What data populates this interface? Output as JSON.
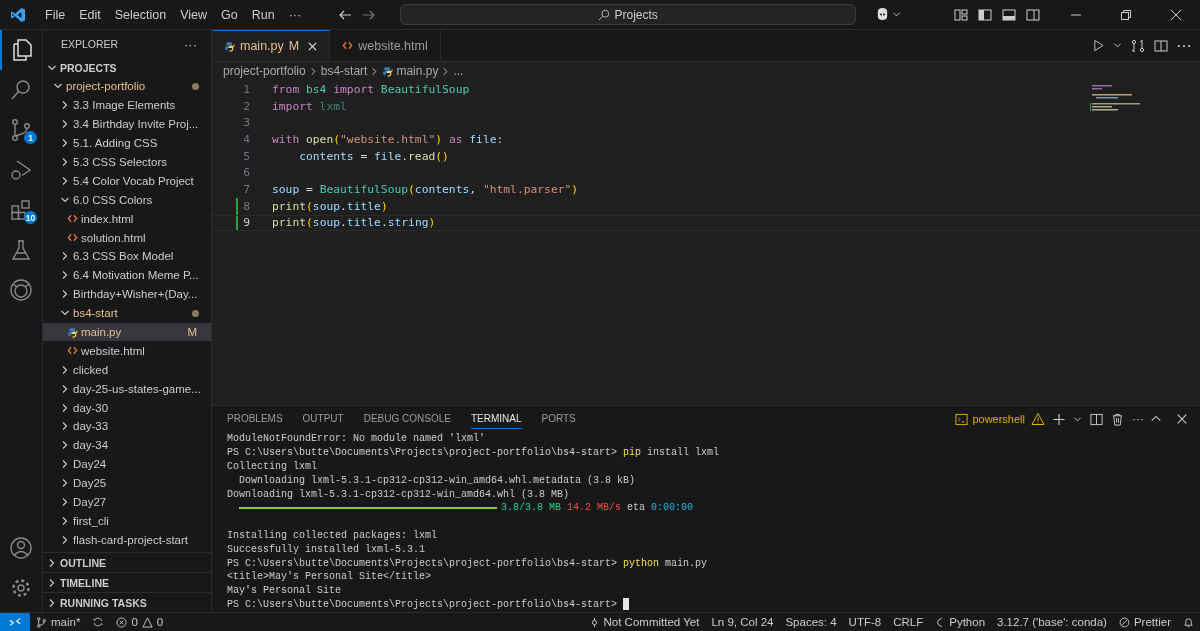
{
  "title_bar": {
    "menu": [
      "File",
      "Edit",
      "Selection",
      "View",
      "Go",
      "Run",
      "···"
    ],
    "search": {
      "value": "Projects"
    }
  },
  "activity_bar": {
    "items": [
      {
        "kind": "explorer",
        "selected": true
      },
      {
        "kind": "search",
        "selected": false
      },
      {
        "kind": "source-control",
        "selected": false,
        "badge": "1"
      },
      {
        "kind": "run",
        "selected": false
      },
      {
        "kind": "extensions",
        "selected": false,
        "badge": "10"
      },
      {
        "kind": "testing",
        "selected": false
      },
      {
        "kind": "copilot",
        "selected": false
      }
    ],
    "bottom": [
      {
        "kind": "account"
      },
      {
        "kind": "settings"
      }
    ]
  },
  "sidebar": {
    "title": "EXPLORER",
    "more": "···",
    "section": {
      "label": "PROJECTS",
      "expanded": true
    },
    "tree": [
      {
        "label": "project-portfolio",
        "kind": "folder",
        "expanded": true,
        "modified": true,
        "children": [
          {
            "label": "3.3 Image Elements",
            "kind": "folder",
            "expanded": false
          },
          {
            "label": "3.4 Birthday Invite Proj...",
            "kind": "folder",
            "expanded": false
          },
          {
            "label": "5.1. Adding CSS",
            "kind": "folder",
            "expanded": false
          },
          {
            "label": "5.3 CSS Selectors",
            "kind": "folder",
            "expanded": false
          },
          {
            "label": "5.4 Color Vocab Project",
            "kind": "folder",
            "expanded": false
          },
          {
            "label": "6.0 CSS Colors",
            "kind": "folder",
            "expanded": true,
            "modified": false,
            "children": [
              {
                "label": "index.html",
                "kind": "html",
                "selected": false
              },
              {
                "label": "solution.html",
                "kind": "html",
                "selected": false
              }
            ]
          },
          {
            "label": "6.3 CSS Box Model",
            "kind": "folder",
            "expanded": false
          },
          {
            "label": "6.4 Motivation Meme P...",
            "kind": "folder",
            "expanded": false
          },
          {
            "label": "Birthday+Wisher+(Day...",
            "kind": "folder",
            "expanded": false
          },
          {
            "label": "bs4-start",
            "kind": "folder",
            "expanded": true,
            "modified": true,
            "children": [
              {
                "label": "main.py",
                "kind": "python",
                "selected": true,
                "badge": "M"
              },
              {
                "label": "website.html",
                "kind": "html",
                "selected": false
              }
            ]
          },
          {
            "label": "clicked",
            "kind": "folder",
            "expanded": false
          },
          {
            "label": "day-25-us-states-game...",
            "kind": "folder",
            "expanded": false
          },
          {
            "label": "day-30",
            "kind": "folder",
            "expanded": false
          },
          {
            "label": "day-33",
            "kind": "folder",
            "expanded": false
          },
          {
            "label": "day-34",
            "kind": "folder",
            "expanded": false
          },
          {
            "label": "Day24",
            "kind": "folder",
            "expanded": false
          },
          {
            "label": "Day25",
            "kind": "folder",
            "expanded": false
          },
          {
            "label": "Day27",
            "kind": "folder",
            "expanded": false
          },
          {
            "label": "first_cli",
            "kind": "folder",
            "expanded": false
          },
          {
            "label": "flash-card-project-start",
            "kind": "folder",
            "expanded": false
          }
        ]
      }
    ],
    "sections": [
      {
        "label": "OUTLINE",
        "expanded": false
      },
      {
        "label": "TIMELINE",
        "expanded": false
      },
      {
        "label": "RUNNING TASKS",
        "expanded": false
      }
    ]
  },
  "editor": {
    "tabs": [
      {
        "label": "main.py",
        "kind": "python",
        "selected": true,
        "badge": "M"
      },
      {
        "label": "website.html",
        "kind": "html",
        "selected": false
      }
    ],
    "breadcrumb": [
      "project-portfolio",
      "bs4-start",
      "main.py",
      "..."
    ],
    "lines": [
      {
        "number": "1",
        "changed": false,
        "current": false,
        "tokens": [
          {
            "t": "from",
            "kind": "keyword"
          },
          {
            "t": " bs4 ",
            "kind": "type"
          },
          {
            "t": "import",
            "kind": "keyword"
          },
          {
            "t": " BeautifulSoup",
            "kind": "type"
          }
        ]
      },
      {
        "number": "2",
        "changed": false,
        "current": false,
        "tokens": [
          {
            "t": "import",
            "kind": "keyword"
          },
          {
            "t": " lxml",
            "kind": "unused"
          }
        ]
      },
      {
        "number": "3",
        "changed": false,
        "current": false
      },
      {
        "number": "4",
        "changed": false,
        "current": false,
        "tokens": [
          {
            "t": "with",
            "kind": "keyword"
          },
          {
            "t": " open",
            "kind": "function"
          },
          {
            "t": "(",
            "kind": "bracket"
          },
          {
            "t": "\"website.html\"",
            "kind": "string"
          },
          {
            "t": ")",
            "kind": "bracket"
          },
          {
            "t": " as",
            "kind": "keyword"
          },
          {
            "t": " file",
            "kind": "variable"
          },
          {
            "t": ":",
            "kind": "plain"
          }
        ]
      },
      {
        "number": "5",
        "changed": false,
        "current": false,
        "tokens": [
          {
            "t": "    contents",
            "kind": "variable"
          },
          {
            "t": " = ",
            "kind": "plain"
          },
          {
            "t": "file",
            "kind": "variable"
          },
          {
            "t": ".",
            "kind": "plain"
          },
          {
            "t": "read",
            "kind": "function"
          },
          {
            "t": "()",
            "kind": "bracket"
          }
        ]
      },
      {
        "number": "6",
        "changed": false,
        "current": false
      },
      {
        "number": "7",
        "changed": false,
        "current": false,
        "tokens": [
          {
            "t": "soup",
            "kind": "variable"
          },
          {
            "t": " = ",
            "kind": "plain"
          },
          {
            "t": "BeautifulSoup",
            "kind": "type"
          },
          {
            "t": "(",
            "kind": "bracket"
          },
          {
            "t": "contents",
            "kind": "variable"
          },
          {
            "t": ", ",
            "kind": "plain"
          },
          {
            "t": "\"html.parser\"",
            "kind": "string"
          },
          {
            "t": ")",
            "kind": "bracket"
          }
        ]
      },
      {
        "number": "8",
        "changed": true,
        "current": false,
        "tokens": [
          {
            "t": "print",
            "kind": "function"
          },
          {
            "t": "(",
            "kind": "bracket"
          },
          {
            "t": "soup",
            "kind": "variable"
          },
          {
            "t": ".",
            "kind": "plain"
          },
          {
            "t": "title",
            "kind": "variable"
          },
          {
            "t": ")",
            "kind": "bracket"
          }
        ]
      },
      {
        "number": "9",
        "changed": true,
        "current": true,
        "tokens": [
          {
            "t": "print",
            "kind": "function"
          },
          {
            "t": "(",
            "kind": "bracket"
          },
          {
            "t": "soup",
            "kind": "variable"
          },
          {
            "t": ".",
            "kind": "plain"
          },
          {
            "t": "title",
            "kind": "variable"
          },
          {
            "t": ".",
            "kind": "plain"
          },
          {
            "t": "string",
            "kind": "variable"
          },
          {
            "t": ")",
            "kind": "bracket"
          }
        ]
      }
    ]
  },
  "panel": {
    "tabs": [
      {
        "label": "PROBLEMS",
        "selected": false
      },
      {
        "label": "OUTPUT",
        "selected": false
      },
      {
        "label": "DEBUG CONSOLE",
        "selected": false
      },
      {
        "label": "TERMINAL",
        "selected": true
      },
      {
        "label": "PORTS",
        "selected": false
      }
    ],
    "terminal_name": "powershell",
    "more": "···",
    "lines": [
      {
        "segments": [
          {
            "t": "ModuleNotFoundError: No module named 'lxml'",
            "kind": "plain"
          }
        ]
      },
      {
        "segments": [
          {
            "t": "PS C:\\Users\\butte\\Documents\\Projects\\project-portfolio\\bs4-start> ",
            "kind": "plain"
          },
          {
            "t": "pip",
            "kind": "command"
          },
          {
            "t": " install lxml",
            "kind": "plain"
          }
        ]
      },
      {
        "segments": [
          {
            "t": "Collecting lxml",
            "kind": "plain"
          }
        ]
      },
      {
        "segments": [
          {
            "t": "  Downloading lxml-5.3.1-cp312-cp312-win_amd64.whl.metadata (3.8 kB)",
            "kind": "plain"
          }
        ]
      },
      {
        "segments": [
          {
            "t": "Downloading lxml-5.3.1-cp312-cp312-win_amd64.whl (3.8 MB)",
            "kind": "plain"
          }
        ]
      },
      {
        "segments": [
          {
            "kind": "bar",
            "level": 1
          },
          {
            "t": "3.8/3.8 MB",
            "kind": "green"
          },
          {
            "t": " 14.2 MB/s",
            "kind": "red"
          },
          {
            "t": " eta ",
            "kind": "plain"
          },
          {
            "t": "0:00:00",
            "kind": "cyan"
          }
        ]
      },
      {
        "gap_before": true,
        "segments": [
          {
            "t": "Installing collected packages: lxml",
            "kind": "plain"
          }
        ]
      },
      {
        "segments": [
          {
            "t": "Successfully installed lxml-5.3.1",
            "kind": "plain"
          }
        ]
      },
      {
        "segments": [
          {
            "t": "PS C:\\Users\\butte\\Documents\\Projects\\project-portfolio\\bs4-start> ",
            "kind": "plain"
          },
          {
            "t": "python",
            "kind": "command"
          },
          {
            "t": " main.py",
            "kind": "plain"
          }
        ]
      },
      {
        "segments": [
          {
            "t": "<title>May's Personal Site</title>",
            "kind": "plain"
          }
        ]
      },
      {
        "segments": [
          {
            "t": "May's Personal Site",
            "kind": "plain"
          }
        ]
      },
      {
        "segments": [
          {
            "t": "PS C:\\Users\\butte\\Documents\\Projects\\project-portfolio\\bs4-start> ",
            "kind": "plain"
          },
          {
            "kind": "cursor"
          }
        ]
      }
    ]
  },
  "status_bar": {
    "branch": "main*",
    "errors": "0",
    "warnings": "0",
    "right": [
      {
        "label": "Not Committed Yet",
        "kind": "commit"
      },
      {
        "label": "Ln 9, Col 24",
        "kind": "text"
      },
      {
        "label": "Spaces: 4",
        "kind": "text"
      },
      {
        "label": "UTF-8",
        "kind": "text"
      },
      {
        "label": "CRLF",
        "kind": "text"
      },
      {
        "label": "Python",
        "kind": "language"
      },
      {
        "label": "3.12.7 ('base': conda)",
        "kind": "text"
      },
      {
        "label": "Prettier",
        "kind": "formatter"
      },
      {
        "kind": "bell"
      }
    ]
  }
}
